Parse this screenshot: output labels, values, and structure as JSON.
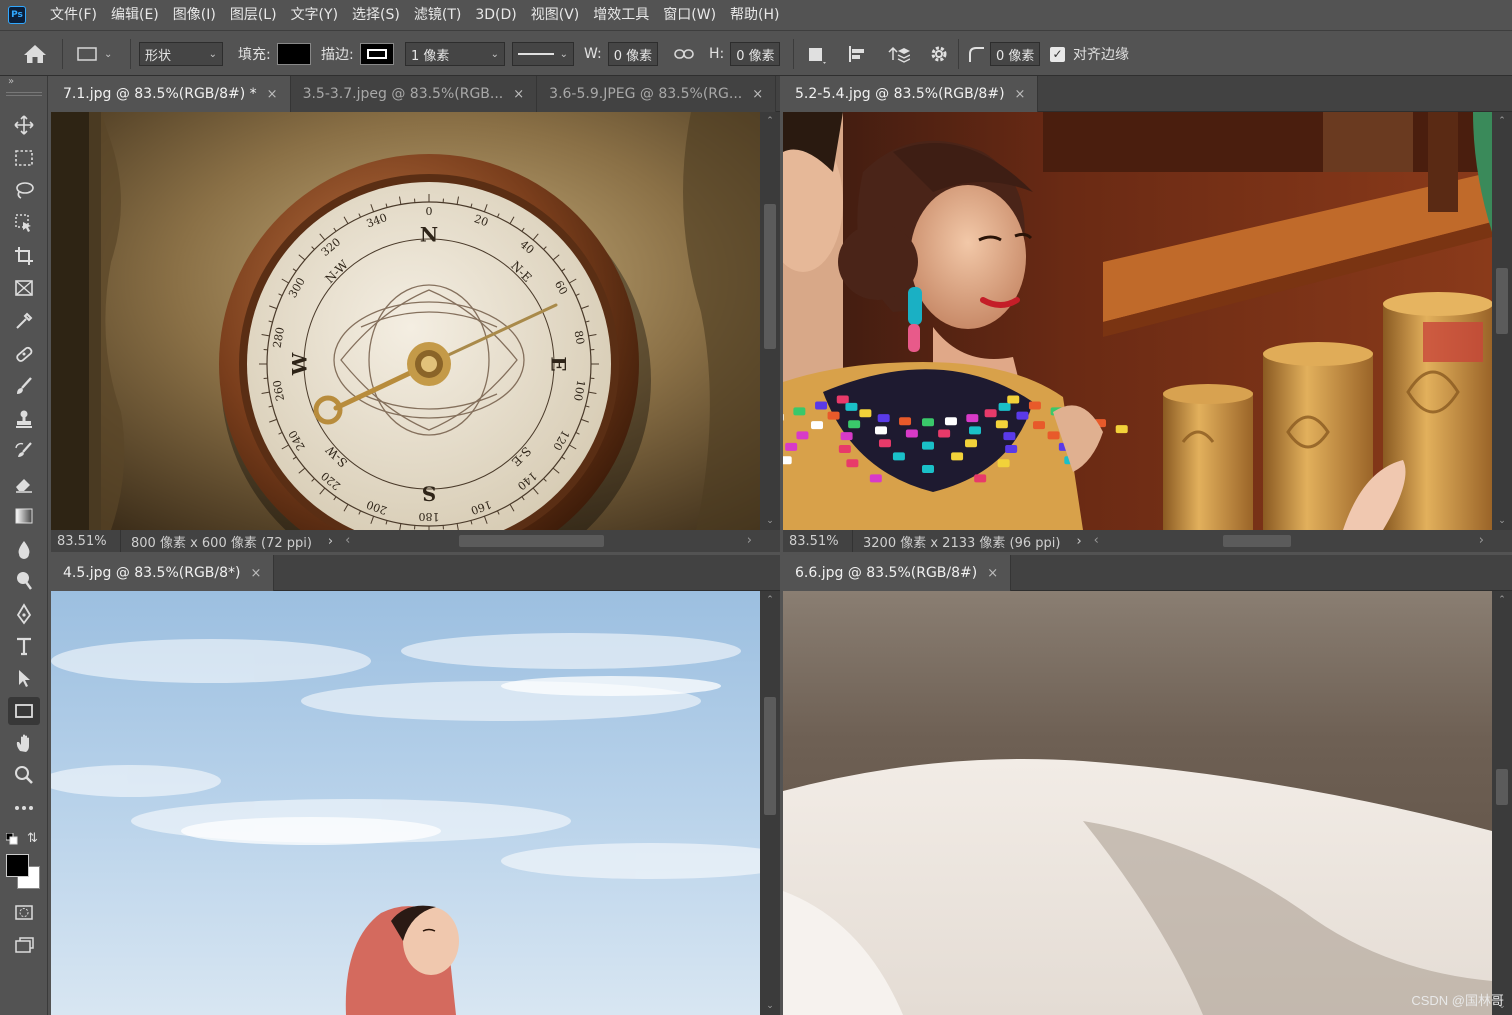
{
  "app": {
    "logo": "Ps"
  },
  "menu": [
    "文件(F)",
    "编辑(E)",
    "图像(I)",
    "图层(L)",
    "文字(Y)",
    "选择(S)",
    "滤镜(T)",
    "3D(D)",
    "视图(V)",
    "增效工具",
    "窗口(W)",
    "帮助(H)"
  ],
  "options": {
    "mode_value": "形状",
    "fill_label": "填充:",
    "stroke_label": "描边:",
    "stroke_width": "1 像素",
    "w_label": "W:",
    "w_value": "0 像素",
    "h_label": "H:",
    "h_value": "0 像素",
    "radius_value": "0 像素",
    "align_edges_label": "对齐边缘",
    "align_edges_checked": true
  },
  "tools": [
    "move-icon",
    "marquee-icon",
    "lasso-icon",
    "object-select-icon",
    "crop-icon",
    "frame-icon",
    "eyedropper-icon",
    "healing-icon",
    "brush-icon",
    "stamp-icon",
    "history-brush-icon",
    "eraser-icon",
    "gradient-icon",
    "blur-icon",
    "dodge-icon",
    "pen-icon",
    "type-icon",
    "path-select-icon",
    "rectangle-icon",
    "hand-icon",
    "zoom-icon",
    "more-icon"
  ],
  "colors": {
    "foreground": "#000000",
    "background": "#ffffff",
    "accent": "#31a8ff"
  },
  "panels": {
    "top_left": {
      "tabs": [
        {
          "label": "7.1.jpg @ 83.5%(RGB/8#) *",
          "active": true
        },
        {
          "label": "3.5-3.7.jpeg @ 83.5%(RGB...",
          "active": false
        },
        {
          "label": "3.6-5.9.JPEG @ 83.5%(RG...",
          "active": false
        }
      ],
      "zoom": "83.51%",
      "dims": "800 像素 x 600 像素 (72 ppi)"
    },
    "top_right": {
      "tabs": [
        {
          "label": "5.2-5.4.jpg @ 83.5%(RGB/8#)",
          "active": true
        }
      ],
      "zoom": "83.51%",
      "dims": "3200 像素 x 2133 像素 (96 ppi)"
    },
    "bottom_left": {
      "tabs": [
        {
          "label": "4.5.jpg @ 83.5%(RGB/8*)",
          "active": true
        }
      ]
    },
    "bottom_right": {
      "tabs": [
        {
          "label": "6.6.jpg @ 83.5%(RGB/8#)",
          "active": true
        }
      ]
    }
  },
  "compass": {
    "cardinals": [
      "N",
      "E",
      "S",
      "W"
    ],
    "intercardinals": [
      "N-E",
      "S-E",
      "S-W",
      "N-W"
    ],
    "degrees": [
      "0",
      "20",
      "40",
      "60",
      "80",
      "100",
      "120",
      "140",
      "160",
      "180",
      "200",
      "220",
      "240",
      "260",
      "280",
      "300",
      "320",
      "340"
    ]
  },
  "watermark": "CSDN @国林哥"
}
